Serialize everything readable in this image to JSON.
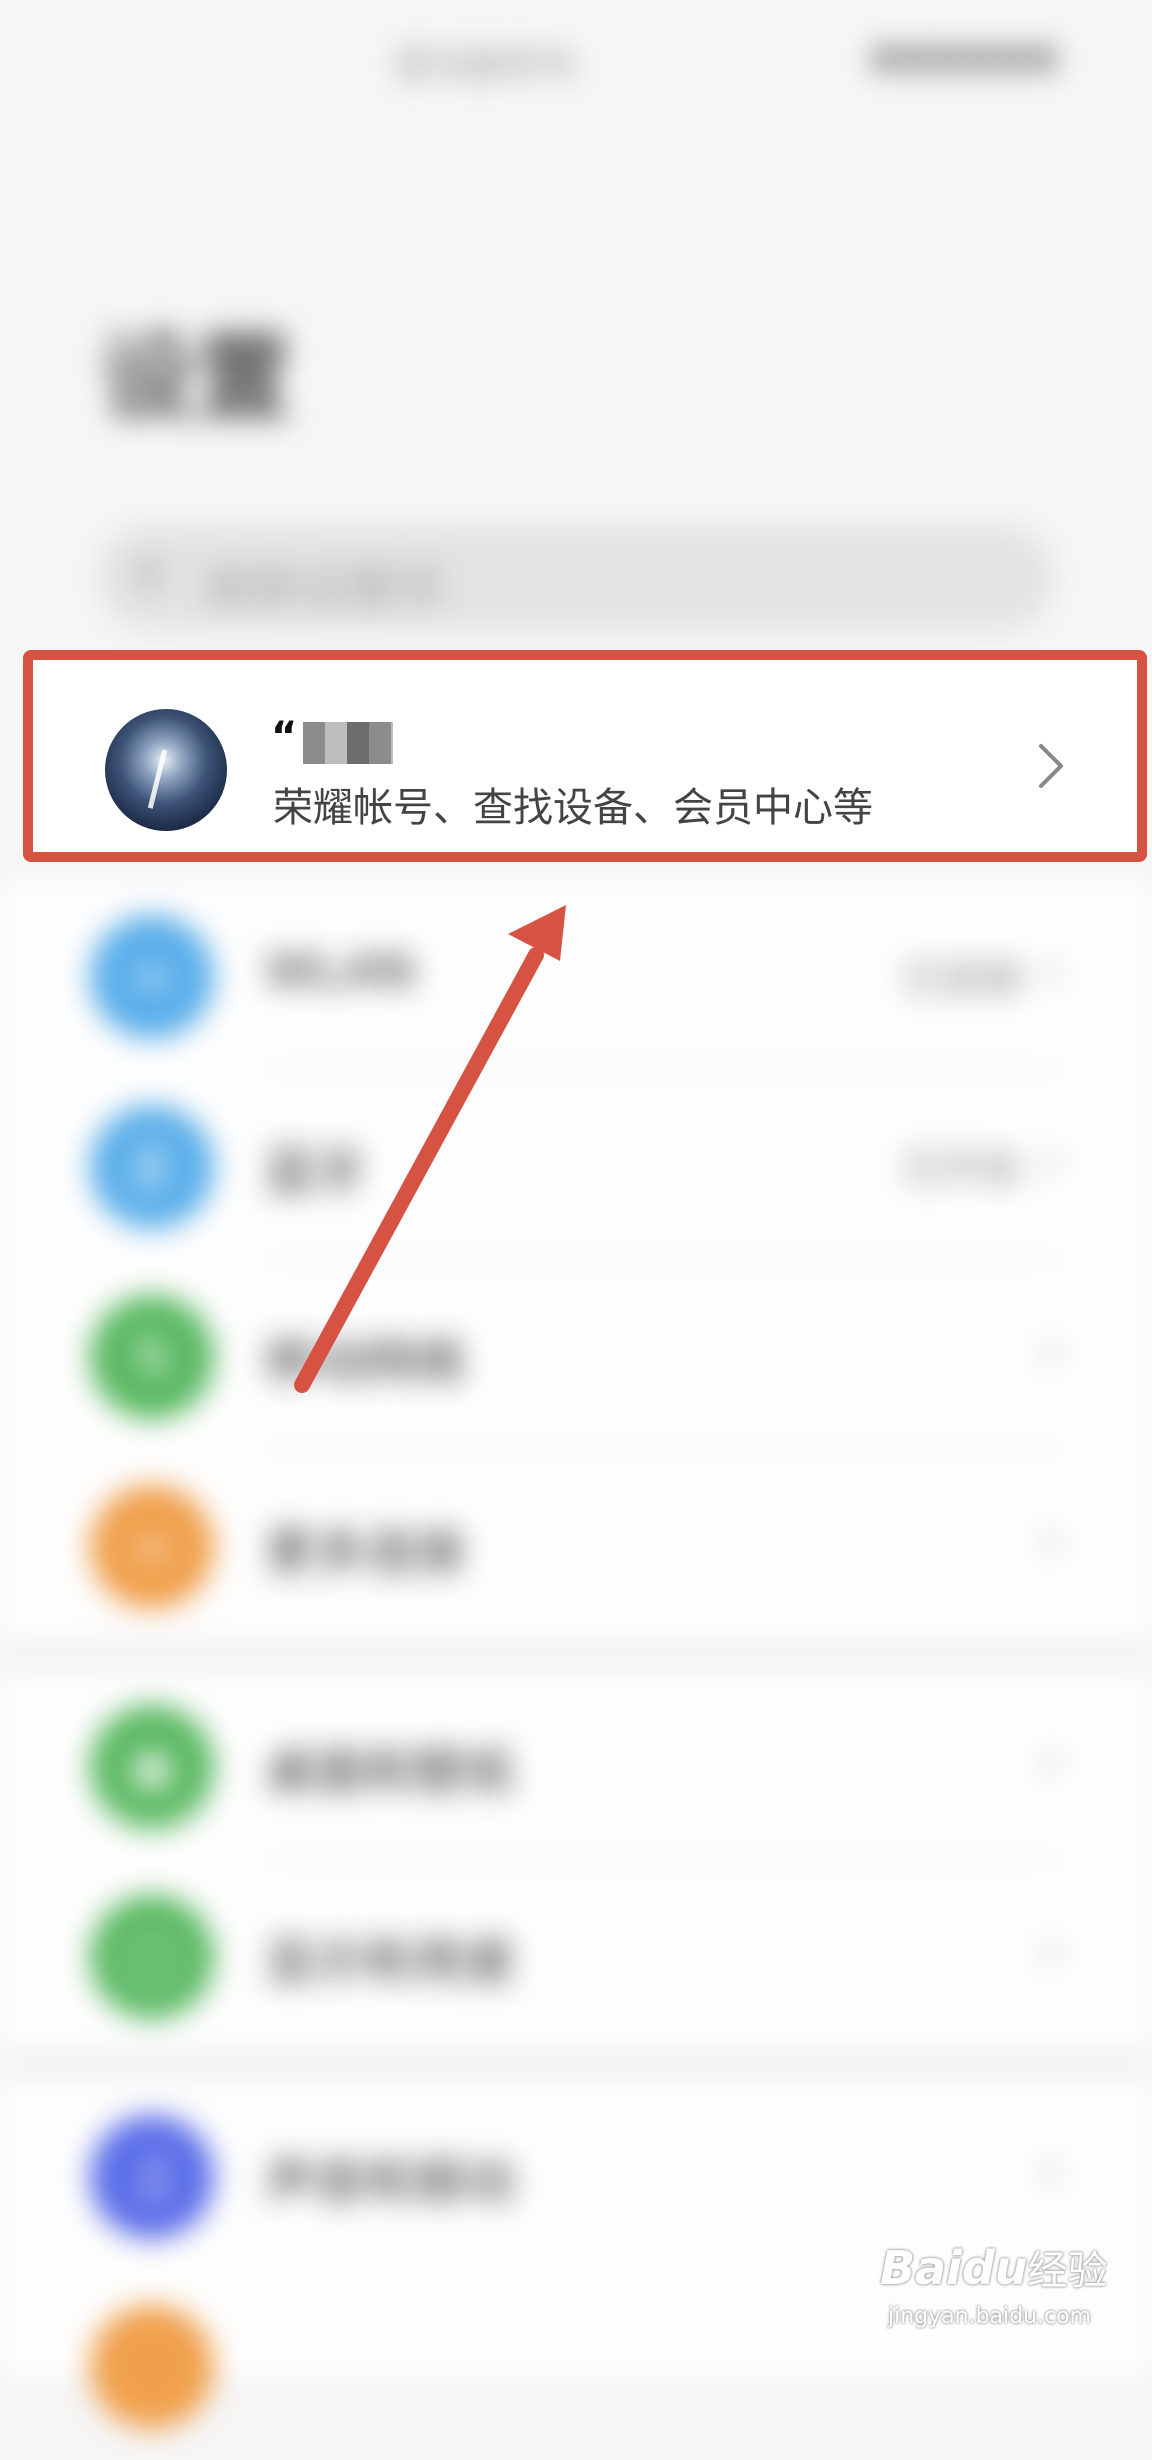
{
  "status_bar": {
    "left_text": "亚马逊华为",
    "right_text": "●●●●●●"
  },
  "page": {
    "title": "设置"
  },
  "search": {
    "placeholder": "搜索设置项"
  },
  "account": {
    "username": "“",
    "description": "荣耀帐号、查找设备、会员中心等"
  },
  "settings_rows": [
    {
      "label": "WLAN",
      "value": "已连接",
      "color": "#5aaeea"
    },
    {
      "label": "蓝牙",
      "value": "已开启",
      "color": "#5aaeea"
    },
    {
      "label": "移动网络",
      "value": "",
      "color": "#58b860"
    },
    {
      "label": "更多连接",
      "value": "",
      "color": "#f0a04b"
    },
    {
      "label": "桌面和壁纸",
      "value": "",
      "color": "#58b860"
    },
    {
      "label": "显示和亮度",
      "value": "",
      "color": "#58b860"
    },
    {
      "label": "声音和振动",
      "value": "",
      "color": "#5a6de8"
    }
  ],
  "watermark": {
    "brand": "Baidu",
    "cn": "经验",
    "url": "jingyan.baidu.com"
  },
  "annotation_color": "#d65343"
}
